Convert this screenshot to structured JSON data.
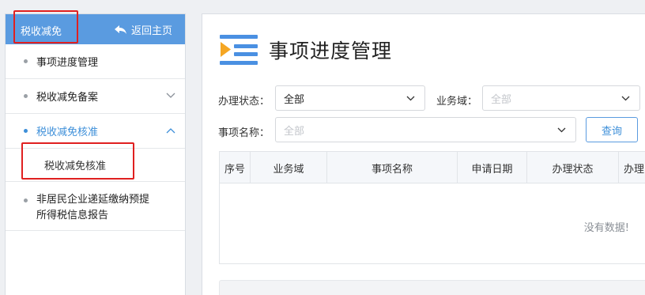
{
  "sidebar": {
    "title": "税收减免",
    "home_label": "返回主页",
    "items": [
      {
        "label": "事项进度管理"
      },
      {
        "label": "税收减免备案"
      },
      {
        "label": "税收减免核准"
      },
      {
        "label": "非居民企业递延缴纳预提所得税信息报告",
        "line1": "非居民企业递延缴纳预提",
        "line2": "所得税信息报告"
      }
    ],
    "sub_item": "税收减免核准",
    "accent_color": "#5a9be0",
    "active_color": "#3d8fd9",
    "highlight_color": "#e02020"
  },
  "main": {
    "title": "事项进度管理",
    "title_icon": "list-play-icon",
    "filters": {
      "status_label": "办理状态：",
      "status_value": "全部",
      "domain_label": "业务域：",
      "domain_placeholder": "全部",
      "name_label": "事项名称：",
      "name_placeholder": "全部",
      "query_button": "查询"
    },
    "table": {
      "headers": [
        "序号",
        "业务域",
        "事项名称",
        "申请日期",
        "办理状态",
        "办理"
      ],
      "empty_text": "没有数据!"
    }
  }
}
